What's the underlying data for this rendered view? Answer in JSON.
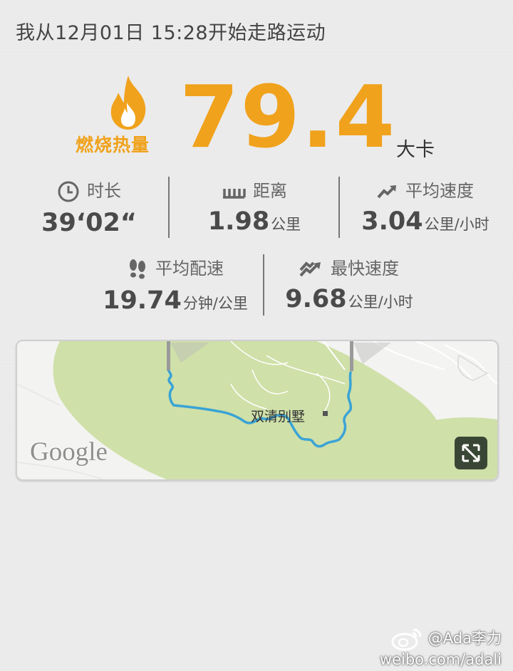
{
  "header": {
    "title": "我从12月01日 15:28开始走路运动"
  },
  "calories": {
    "label": "燃烧热量",
    "value": "79.4",
    "unit": "大卡",
    "accent_color": "#f0a21c",
    "icon": "flame-icon"
  },
  "stats": {
    "duration": {
      "icon": "clock-icon",
      "label": "时长",
      "value": "39‘02“",
      "unit": ""
    },
    "distance": {
      "icon": "ruler-icon",
      "label": "距离",
      "value": "1.98",
      "unit": "公里"
    },
    "avg_speed": {
      "icon": "trend-arrow-icon",
      "label": "平均速度",
      "value": "3.04",
      "unit": "公里/小时"
    },
    "avg_pace": {
      "icon": "footprints-icon",
      "label": "平均配速",
      "value": "19.74",
      "unit": "分钟/公里"
    },
    "max_speed": {
      "icon": "fast-arrow-icon",
      "label": "最快速度",
      "value": "9.68",
      "unit": "公里/小时"
    }
  },
  "map": {
    "place_label": "双清别墅",
    "provider": "Google",
    "route_color": "#3aa3d6",
    "park_color": "#cfe0a8",
    "expand_icon": "expand-icon"
  },
  "watermark": {
    "handle": "@Ada李力",
    "url": "weibo.com/adali",
    "icon": "weibo-icon"
  }
}
